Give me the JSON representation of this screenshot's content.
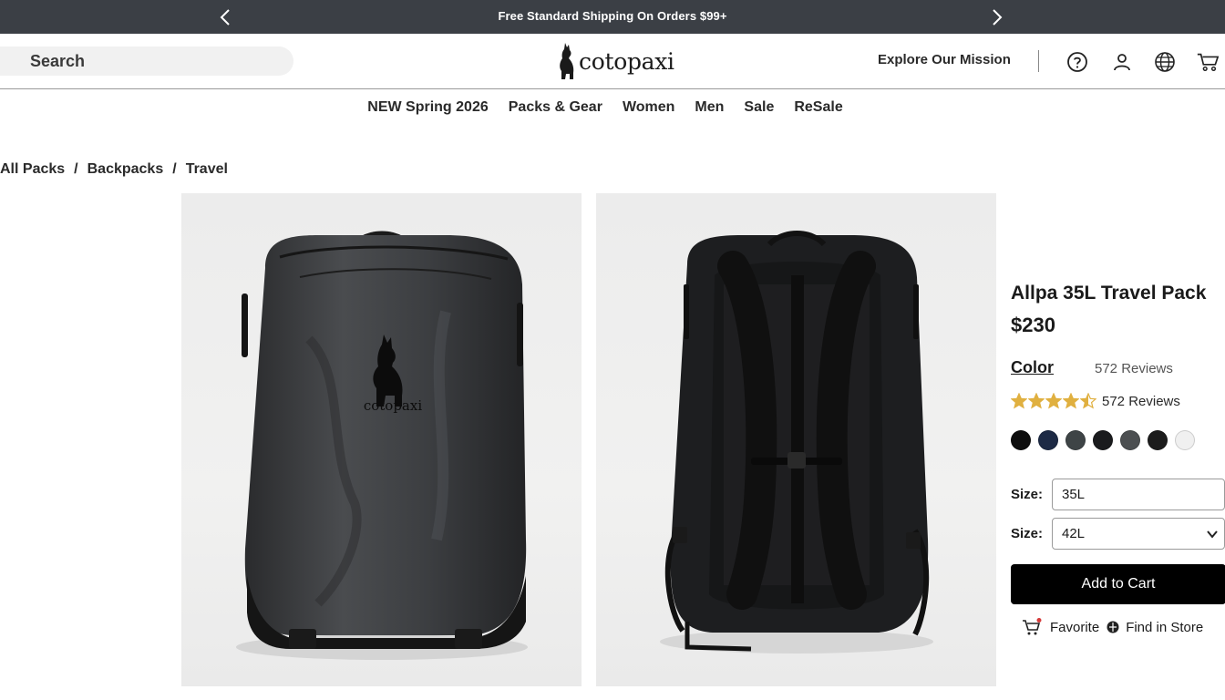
{
  "announcement": {
    "text": "Free Standard Shipping On Orders $99+",
    "prev_icon": "chevron-left-icon",
    "next_icon": "chevron-right-icon"
  },
  "header": {
    "search_label": "Search",
    "logo_text": "cotopaxi",
    "mission_link": "Explore Our Mission",
    "icons": [
      "help-icon",
      "account-icon",
      "globe-icon",
      "cart-icon"
    ]
  },
  "nav": {
    "items": [
      "NEW Spring 2026",
      "Packs & Gear",
      "Women",
      "Men",
      "Sale",
      "ReSale"
    ]
  },
  "breadcrumb": {
    "items": [
      "All Packs",
      "Backpacks",
      "Travel"
    ],
    "separator": "/"
  },
  "gallery": {
    "front_logo_text": "cotopaxi"
  },
  "product": {
    "title": "Allpa 35L Travel Pack",
    "price": "$230",
    "color_label": "Color",
    "reviews_plain": "572 Reviews",
    "rating_value": 4.5,
    "rating_max": 5,
    "rating_text": "572 Reviews",
    "swatches": [
      "#0d0d0d",
      "#1d2a45",
      "#3e4446",
      "#1a1b1d",
      "#4c4f51",
      "#1c1c1c",
      "#f0f0f0"
    ],
    "star_color": "#e0b040",
    "size_label_1": "Size:",
    "size_value_1": "35L",
    "size_label_2": "Size:",
    "size_value_2": "42L",
    "add_to_cart": "Add to Cart",
    "favorite_label": "Favorite",
    "find_store_label": "Find in Store"
  }
}
